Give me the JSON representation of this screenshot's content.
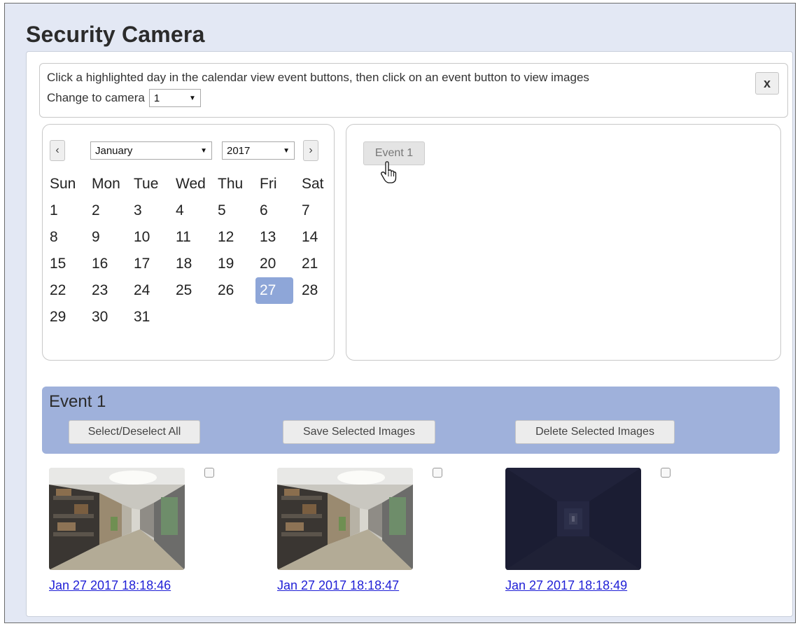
{
  "app": {
    "title": "Security Camera"
  },
  "instructions": {
    "text": "Click a highlighted day in the calendar view event buttons, then click on an event button to view images",
    "camera_label": "Change to camera",
    "camera_value": "1",
    "close_label": "x"
  },
  "calendar": {
    "prev_label": "‹",
    "next_label": "›",
    "month": "January",
    "year": "2017",
    "weekdays": [
      "Sun",
      "Mon",
      "Tue",
      "Wed",
      "Thu",
      "Fri",
      "Sat"
    ],
    "days": [
      [
        "1",
        "2",
        "3",
        "4",
        "5",
        "6",
        "7"
      ],
      [
        "8",
        "9",
        "10",
        "11",
        "12",
        "13",
        "14"
      ],
      [
        "15",
        "16",
        "17",
        "18",
        "19",
        "20",
        "21"
      ],
      [
        "22",
        "23",
        "24",
        "25",
        "26",
        "27",
        "28"
      ],
      [
        "29",
        "30",
        "31",
        "",
        "",
        "",
        ""
      ]
    ],
    "selected_day": "27",
    "selected_color": "#8ea6d8"
  },
  "events": {
    "buttons": [
      {
        "label": "Event 1"
      }
    ]
  },
  "event_panel": {
    "title": "Event 1",
    "select_all_label": "Select/Deselect All",
    "save_label": "Save Selected Images",
    "delete_label": "Delete Selected Images",
    "bar_color": "#9fb1db"
  },
  "images": [
    {
      "timestamp": "Jan 27 2017 18:18:46",
      "lighting": "lit"
    },
    {
      "timestamp": "Jan 27 2017 18:18:47",
      "lighting": "lit"
    },
    {
      "timestamp": "Jan 27 2017 18:18:49",
      "lighting": "dark"
    }
  ]
}
